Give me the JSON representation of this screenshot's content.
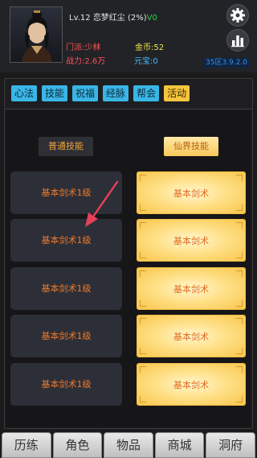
{
  "player": {
    "level": "Lv.12",
    "name": "恋梦红尘",
    "exp_percent": "(2%)",
    "vip": "V0",
    "sect": "门派:少林",
    "power": "战力:2.6万",
    "gold": "金币:52",
    "ingot": "元宝:0",
    "server": "35区3.9.2.0"
  },
  "tabs": [
    "心法",
    "技能",
    "祝福",
    "经脉",
    "帮会",
    "活动"
  ],
  "active_tab": "活动",
  "columns": {
    "normal": "普通技能",
    "immortal": "仙界技能"
  },
  "normal_skills": [
    "基本剑术1级",
    "基本剑术1级",
    "基本剑术1级",
    "基本剑术1级",
    "基本剑术1级"
  ],
  "immortal_skills": [
    "基本剑术",
    "基本剑术",
    "基本剑术",
    "基本剑术",
    "基本剑术"
  ],
  "bottom_nav": [
    "历练",
    "角色",
    "物品",
    "商城",
    "洞府"
  ],
  "colors": {
    "tab": "#3ab6e6",
    "active_tab": "#f5c53d",
    "skill_text": "#f07a28",
    "arrow": "#e8405a"
  },
  "icons": [
    "gear-icon",
    "stats-icon",
    "annotation-arrow"
  ]
}
